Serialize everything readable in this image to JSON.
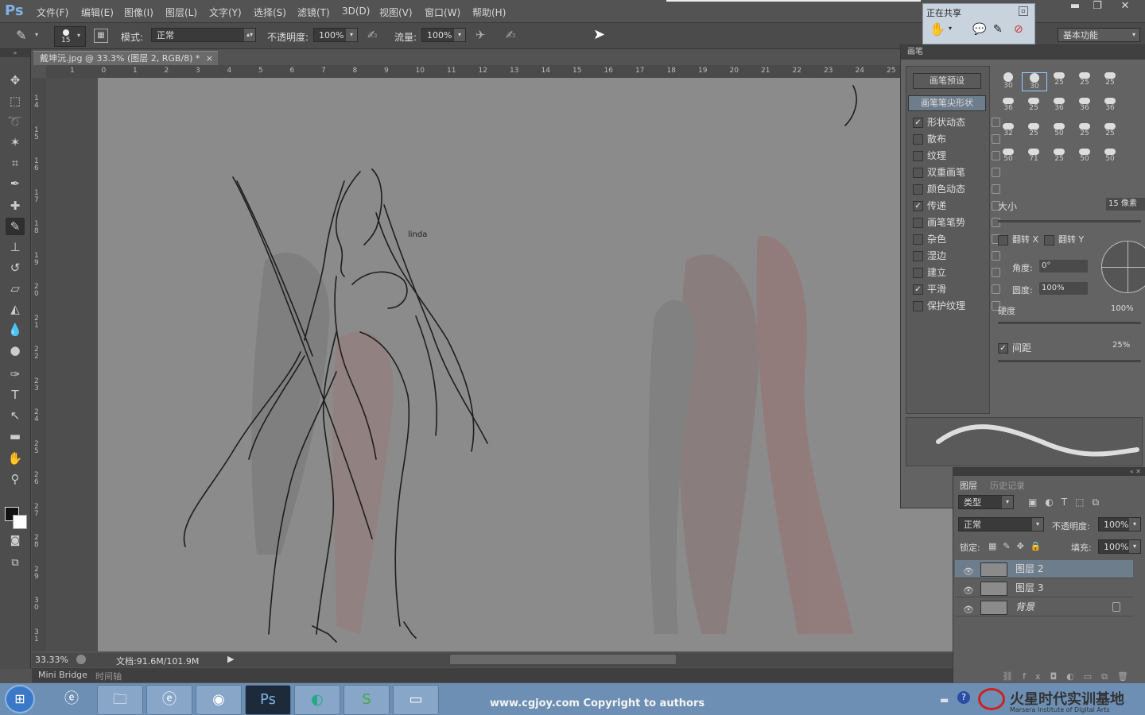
{
  "app": {
    "logo": "Ps"
  },
  "menu": [
    "文件(F)",
    "编辑(E)",
    "图像(I)",
    "图层(L)",
    "文字(Y)",
    "选择(S)",
    "滤镜(T)",
    "3D(D)",
    "视图(V)",
    "窗口(W)",
    "帮助(H)"
  ],
  "window": {
    "minimize": "▬",
    "restore": "❐",
    "close": "✕"
  },
  "options": {
    "brush_size": "15",
    "mode_label": "模式:",
    "mode_value": "正常",
    "opacity_label": "不透明度:",
    "opacity_value": "100%",
    "flow_label": "流量:",
    "flow_value": "100%",
    "workspace": "基本功能"
  },
  "share": {
    "title": "正在共享"
  },
  "document": {
    "tab": "戴坤沅.jpg @ 33.3% (图层 2, RGB/8) *",
    "close": "×"
  },
  "ruler_h": [
    "1",
    "0",
    "1",
    "2",
    "3",
    "4",
    "5",
    "6",
    "7",
    "8",
    "9",
    "10",
    "11",
    "12",
    "13",
    "14",
    "15",
    "16",
    "17",
    "18",
    "19",
    "20",
    "21",
    "22",
    "23",
    "24",
    "25"
  ],
  "ruler_v": [
    "14",
    "15",
    "16",
    "17",
    "18",
    "19",
    "20",
    "21",
    "22",
    "23",
    "24",
    "25",
    "26",
    "27",
    "28",
    "29",
    "30",
    "31"
  ],
  "canvas": {
    "handwritten": "linda"
  },
  "status": {
    "zoom": "33.33%",
    "doc": "文档:91.6M/101.9M"
  },
  "bottom_tabs": [
    "Mini Bridge",
    "时间轴"
  ],
  "brush_panel": {
    "title": "画笔",
    "preset_button": "画笔预设",
    "tip_button": "画笔笔尖形状",
    "options": [
      {
        "label": "形状动态",
        "checked": true
      },
      {
        "label": "散布",
        "checked": false
      },
      {
        "label": "纹理",
        "checked": false
      },
      {
        "label": "双重画笔",
        "checked": false
      },
      {
        "label": "颜色动态",
        "checked": false
      },
      {
        "label": "传递",
        "checked": true
      },
      {
        "label": "画笔笔势",
        "checked": false
      },
      {
        "label": "杂色",
        "checked": false
      },
      {
        "label": "湿边",
        "checked": false
      },
      {
        "label": "建立",
        "checked": false
      },
      {
        "label": "平滑",
        "checked": true
      },
      {
        "label": "保护纹理",
        "checked": false
      }
    ],
    "tip_sizes": [
      "30",
      "30",
      "25",
      "25",
      "25",
      "36",
      "25",
      "36",
      "36",
      "36",
      "32",
      "25",
      "50",
      "25",
      "25",
      "50",
      "71",
      "25",
      "50",
      "50"
    ],
    "size_label": "大小",
    "size_value": "15 像素",
    "flip_x": "翻转 X",
    "flip_y": "翻转 Y",
    "angle_label": "角度:",
    "angle_value": "0°",
    "roundness_label": "圆度:",
    "roundness_value": "100%",
    "hardness_label": "硬度",
    "hardness_value": "100%",
    "spacing_label": "间距",
    "spacing_value": "25%"
  },
  "layers_panel": {
    "tabs": [
      "图层",
      "历史记录"
    ],
    "filter": "类型",
    "blend": "正常",
    "opacity_label": "不透明度:",
    "opacity_value": "100%",
    "lock_label": "锁定:",
    "fill_label": "填充:",
    "fill_value": "100%",
    "layers": [
      {
        "name": "图层 2",
        "selected": true
      },
      {
        "name": "图层 3",
        "selected": false
      },
      {
        "name": "背景",
        "selected": false
      }
    ]
  },
  "taskbar": {
    "copyright": "www.cgjoy.com Copyright to authors",
    "watermark": "火星时代实训基地",
    "watermark_sub": "Marsera Institute of Digital Arts"
  }
}
